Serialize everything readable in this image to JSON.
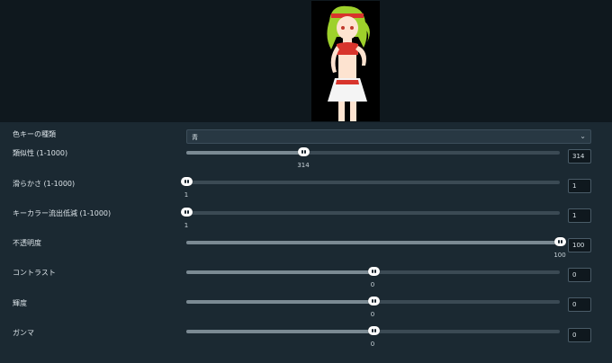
{
  "key_type": {
    "label": "色キーの種類",
    "selected": "青"
  },
  "sliders": [
    {
      "id": "similarity",
      "label": "類似性 (1-1000)",
      "value": "314",
      "position": 0.313
    },
    {
      "id": "smoothness",
      "label": "滑らかさ (1-1000)",
      "value": "1",
      "position": 0.0
    },
    {
      "id": "spill",
      "label": "キーカラー流出低減 (1-1000)",
      "value": "1",
      "position": 0.0
    },
    {
      "id": "opacity",
      "label": "不透明度",
      "value": "100",
      "position": 1.0
    },
    {
      "id": "contrast",
      "label": "コントラスト",
      "value": "0",
      "position": 0.5
    },
    {
      "id": "brightness",
      "label": "輝度",
      "value": "0",
      "position": 0.5
    },
    {
      "id": "gamma",
      "label": "ガンマ",
      "value": "0",
      "position": 0.5
    }
  ],
  "colors": {
    "preview_background": "#000000",
    "panel_background": "#1b2932",
    "track": "#3b4a54",
    "thumb": "#ffffff"
  }
}
